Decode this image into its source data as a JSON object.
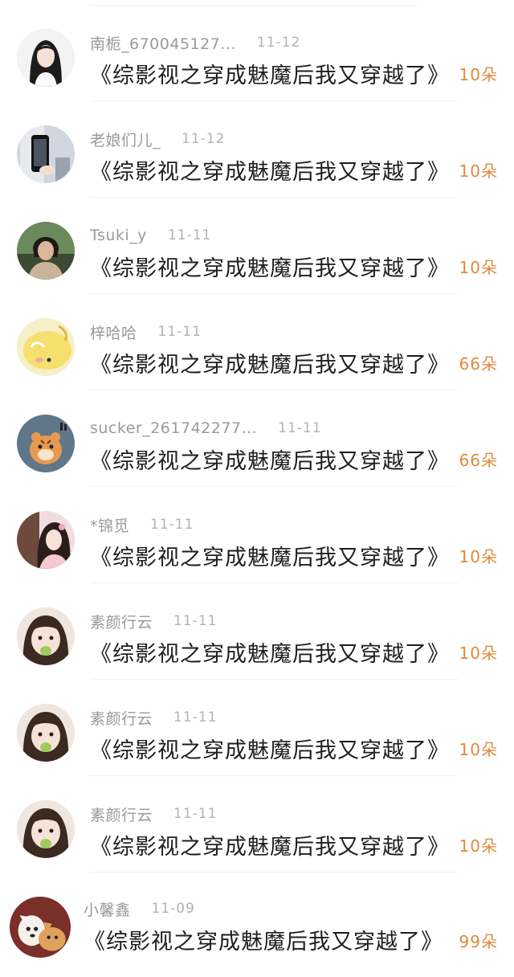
{
  "records": [
    {
      "username": "南栀_670045127...",
      "time": "11-12",
      "book": "《综影视之穿成魅魔后我又穿越了》",
      "flowers": "10朵",
      "avatar_icon": "avatar-girl-black-hair-icon"
    },
    {
      "username": "老娘们儿_",
      "time": "11-12",
      "book": "《综影视之穿成魅魔后我又穿越了》",
      "flowers": "10朵",
      "avatar_icon": "avatar-phone-selfie-icon"
    },
    {
      "username": "Tsuki_y",
      "time": "11-11",
      "book": "《综影视之穿成魅魔后我又穿越了》",
      "flowers": "10朵",
      "avatar_icon": "avatar-person-portrait-icon"
    },
    {
      "username": "梓哈哈",
      "time": "11-11",
      "book": "《综影视之穿成魅魔后我又穿越了》",
      "flowers": "66朵",
      "avatar_icon": "avatar-yellow-cartoon-icon"
    },
    {
      "username": "sucker_261742277...",
      "time": "11-11",
      "book": "《综影视之穿成魅魔后我又穿越了》",
      "flowers": "66朵",
      "avatar_icon": "avatar-tiger-cartoon-icon"
    },
    {
      "username": "*锦觅",
      "time": "11-11",
      "book": "《综影视之穿成魅魔后我又穿越了》",
      "flowers": "10朵",
      "avatar_icon": "avatar-costume-girl-icon"
    },
    {
      "username": "素颜行云",
      "time": "11-11",
      "book": "《综影视之穿成魅魔后我又穿越了》",
      "flowers": "10朵",
      "avatar_icon": "avatar-child-leaf-icon"
    },
    {
      "username": "素颜行云",
      "time": "11-11",
      "book": "《综影视之穿成魅魔后我又穿越了》",
      "flowers": "10朵",
      "avatar_icon": "avatar-child-leaf-icon"
    },
    {
      "username": "素颜行云",
      "time": "11-11",
      "book": "《综影视之穿成魅魔后我又穿越了》",
      "flowers": "10朵",
      "avatar_icon": "avatar-child-leaf-icon"
    },
    {
      "username": "小馨鑫",
      "time": "11-09",
      "book": "《综影视之穿成魅魔后我又穿越了》",
      "flowers": "99朵",
      "avatar_icon": "avatar-dogs-icon"
    }
  ],
  "colors": {
    "username": "#9a9a9a",
    "time": "#b3b3b3",
    "book": "#1e1e1e",
    "flowers": "#e08a3c",
    "divider": "#f1f1f1"
  }
}
